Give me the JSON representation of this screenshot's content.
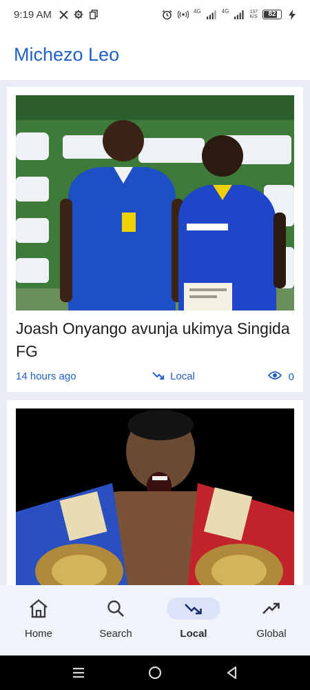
{
  "status_bar": {
    "time": "9:19 AM",
    "left_icons": [
      "x-icon",
      "gear-icon",
      "copy-icon"
    ],
    "network_labels": [
      "4G",
      "4G"
    ],
    "speed_value": "137",
    "speed_unit": "K/S",
    "battery": "82",
    "battery_level": 0.82
  },
  "app": {
    "title": "Michezo Leo"
  },
  "feed": {
    "articles": [
      {
        "title": "Joash Onyango avunja ukimya Singida FG",
        "time": "14 hours ago",
        "category": "Local",
        "views": "0"
      }
    ]
  },
  "bottom_nav": {
    "items": [
      {
        "label": "Home",
        "icon": "home-icon"
      },
      {
        "label": "Search",
        "icon": "search-icon"
      },
      {
        "label": "Local",
        "icon": "trending-down-icon",
        "active": true
      },
      {
        "label": "Global",
        "icon": "trending-up-icon"
      }
    ]
  },
  "colors": {
    "accent": "#1f5fc8",
    "nav_active_pill": "#dbe3f8"
  }
}
